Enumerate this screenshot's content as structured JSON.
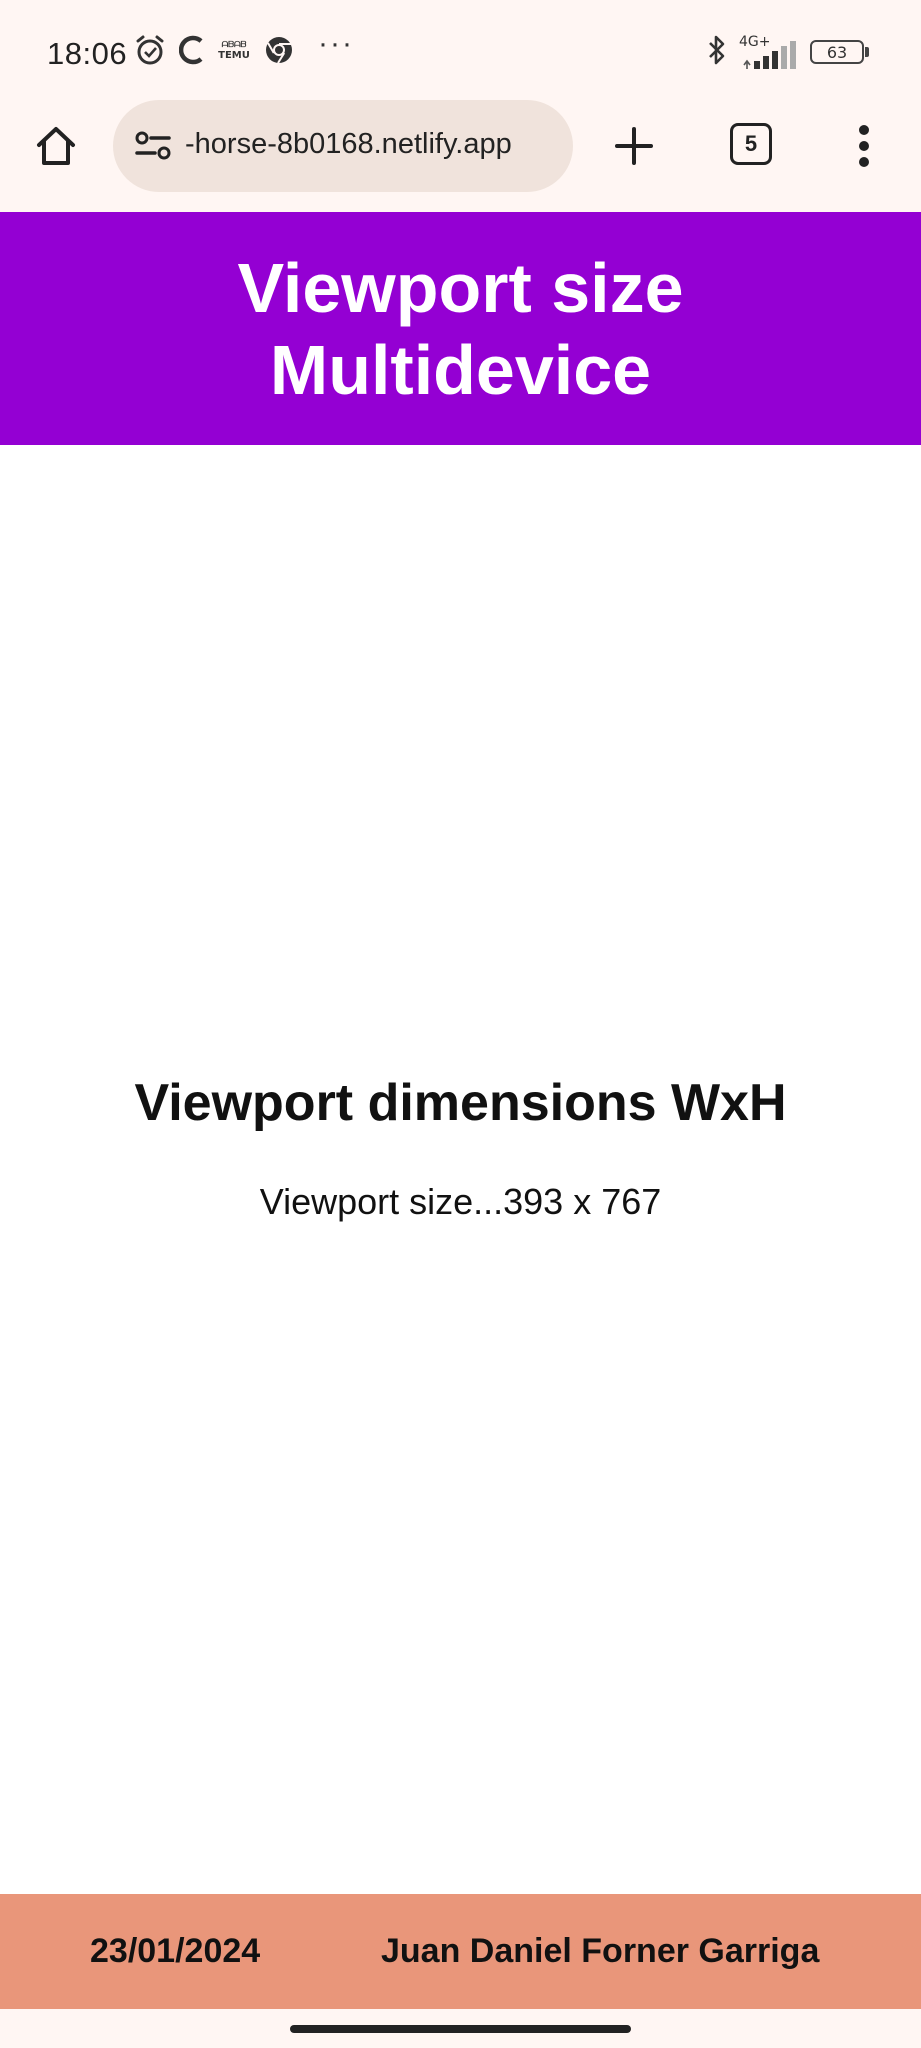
{
  "status_bar": {
    "time": "18:06",
    "temu_top": "ᗩᗷᗩᗷ",
    "temu_bottom": "TEMU",
    "more": "···",
    "network": "4G+",
    "battery": "63"
  },
  "browser": {
    "url": "-horse-8b0168.netlify.app",
    "tab_count": "5"
  },
  "header": {
    "line1": "Viewport size",
    "line2": "Multidevice"
  },
  "main": {
    "title": "Viewport dimensions WxH",
    "size_text": "Viewport size...393 x 767"
  },
  "footer": {
    "date": "23/01/2024",
    "author": "Juan Daniel Forner Garriga"
  },
  "colors": {
    "header_bg": "#9400d3",
    "footer_bg": "#e9967a",
    "chrome_bg": "#fff6f3",
    "omnibox_bg": "#f0e3dc"
  }
}
